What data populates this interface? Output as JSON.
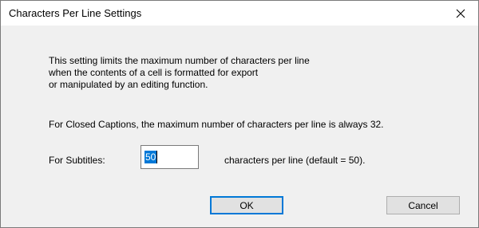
{
  "dialog": {
    "title": "Characters Per Line Settings",
    "close_icon": "close-icon"
  },
  "message": {
    "line1": "This setting limits the maximum number of characters per line",
    "line2": "when the contents of a cell is formatted for export",
    "line3": "or manipulated by an editing function."
  },
  "closed_captions_note": "For Closed Captions, the maximum number of characters per line is always 32.",
  "subtitles": {
    "label": "For Subtitles:",
    "value": "50",
    "suffix": "characters per line (default = 50)."
  },
  "buttons": {
    "ok": "OK",
    "cancel": "Cancel"
  },
  "colors": {
    "accent": "#0078d7",
    "dialog_bg": "#f0f0f0",
    "titlebar_bg": "#ffffff"
  }
}
